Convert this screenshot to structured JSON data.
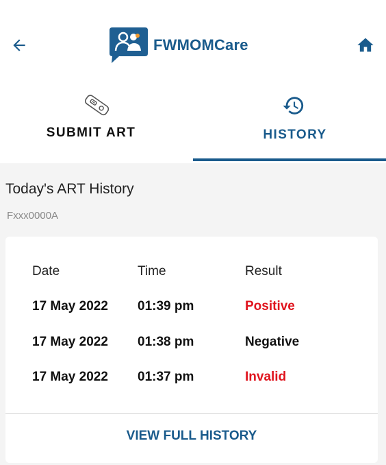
{
  "header": {
    "title": "FWMOMCare",
    "back_icon": "arrow-left-icon",
    "home_icon": "home-icon",
    "logo_icon": "family-logo-icon",
    "brand_color": "#1a5b8c"
  },
  "tabs": [
    {
      "label": "SUBMIT ART",
      "icon": "test-kit-icon",
      "active": false
    },
    {
      "label": "HISTORY",
      "icon": "history-icon",
      "active": true
    }
  ],
  "history": {
    "title": "Today's ART History",
    "user_id": "Fxxx0000A",
    "columns": [
      "Date",
      "Time",
      "Result"
    ],
    "rows": [
      {
        "date": "17 May 2022",
        "time": "01:39 pm",
        "result": "Positive",
        "result_color": "#e0141e"
      },
      {
        "date": "17 May 2022",
        "time": "01:38 pm",
        "result": "Negative",
        "result_color": "#111111"
      },
      {
        "date": "17 May 2022",
        "time": "01:37 pm",
        "result": "Invalid",
        "result_color": "#e0141e"
      }
    ],
    "view_full_label": "VIEW FULL HISTORY"
  }
}
